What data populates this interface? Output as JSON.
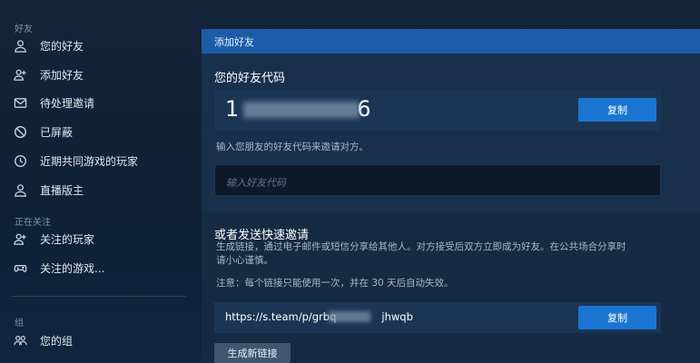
{
  "sidebar": {
    "friends_header": "好友",
    "items": [
      {
        "label": "您的好友",
        "icon": "person-icon"
      },
      {
        "label": "添加好友",
        "icon": "add-person-icon"
      },
      {
        "label": "待处理邀请",
        "icon": "envelope-icon"
      },
      {
        "label": "已屏蔽",
        "icon": "blocked-icon"
      },
      {
        "label": "近期共同游戏的玩家",
        "icon": "clock-icon"
      },
      {
        "label": "直播版主",
        "icon": "person-icon"
      }
    ],
    "following_header": "正在关注",
    "following_items": [
      {
        "label": "关注的玩家",
        "icon": "add-person-icon"
      },
      {
        "label": "关注的游戏...",
        "icon": "gamepad-icon"
      }
    ],
    "groups_header": "组",
    "group_items": [
      {
        "label": "您的组",
        "icon": "group-icon"
      }
    ]
  },
  "panel": {
    "header": "添加好友",
    "friend_code_title": "您的好友代码",
    "friend_code_start": "1",
    "friend_code_end": "6",
    "copy_label": "复制",
    "instructions": "输入您朋友的好友代码来邀请对方。",
    "input_placeholder": "输入好友代码",
    "quick_invite_title": "或者发送快速邀请",
    "quick_invite_desc_line1": "生成链接，通过电子邮件或短信分享给其他人。对方接受后双方立即成为好友。在公共场合分享时",
    "quick_invite_desc_line2": "请小心谨慎。",
    "note": "注意：每个链接只能使用一次，并在 30 天后自动失效。",
    "link_start": "https://s.team/p/grbq",
    "link_end": "jhwqb",
    "generate_label": "生成新链接"
  }
}
